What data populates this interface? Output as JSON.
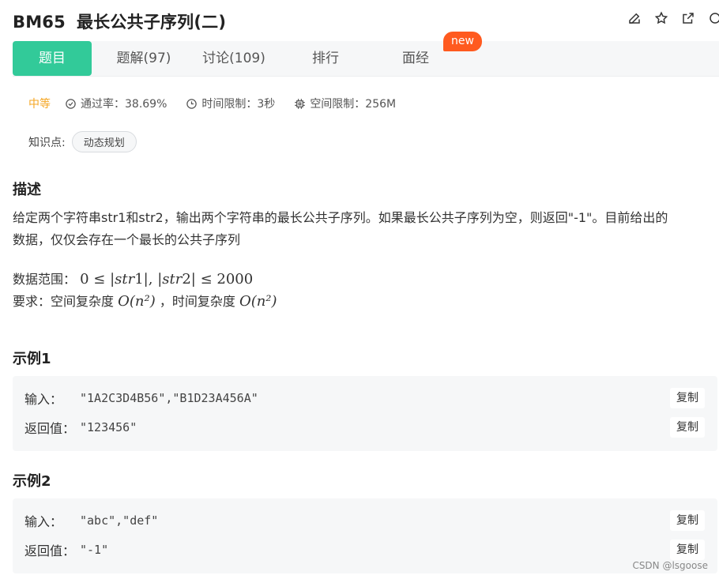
{
  "problem": {
    "code": "BM65",
    "title": "最长公共子序列(二)"
  },
  "tabs": [
    {
      "label": "题目",
      "active": true
    },
    {
      "label": "题解(97)",
      "active": false
    },
    {
      "label": "讨论(109)",
      "active": false
    },
    {
      "label": "排行",
      "active": false
    },
    {
      "label": "面经",
      "active": false
    }
  ],
  "new_badge": "new",
  "meta": {
    "difficulty": "中等",
    "pass_rate": "通过率：38.69%",
    "time_limit": "时间限制：3秒",
    "space_limit": "空间限制：256M"
  },
  "knowledge": {
    "label": "知识点:",
    "tag": "动态规划"
  },
  "description": {
    "heading": "描述",
    "line1": "给定两个字符串str1和str2，输出两个字符串的最长公共子序列。如果最长公共子序列为空，则返回\"-1\"。目前给出的",
    "line2": "数据，仅仅会存在一个最长的公共子序列"
  },
  "constraints": {
    "range_label": "数据范围：",
    "range_math_a": "0 ≤ |",
    "range_math_b": "str",
    "range_math_c": "1|, |",
    "range_math_d": "str",
    "range_math_e": "2| ≤ 2000",
    "req_label": "要求：空间复杂度",
    "req_space": "O(n²)",
    "req_sep": "，时间复杂度",
    "req_time": "O(n²)"
  },
  "examples": [
    {
      "heading": "示例1",
      "input_label": "输入：",
      "input": "\"1A2C3D4B56\",\"B1D23A456A\"",
      "output_label": "返回值：",
      "output": "\"123456\"",
      "copy": "复制"
    },
    {
      "heading": "示例2",
      "input_label": "输入：",
      "input": "\"abc\",\"def\"",
      "output_label": "返回值：",
      "output": "\"-1\"",
      "copy": "复制"
    }
  ],
  "watermark": "CSDN @lsgoose"
}
